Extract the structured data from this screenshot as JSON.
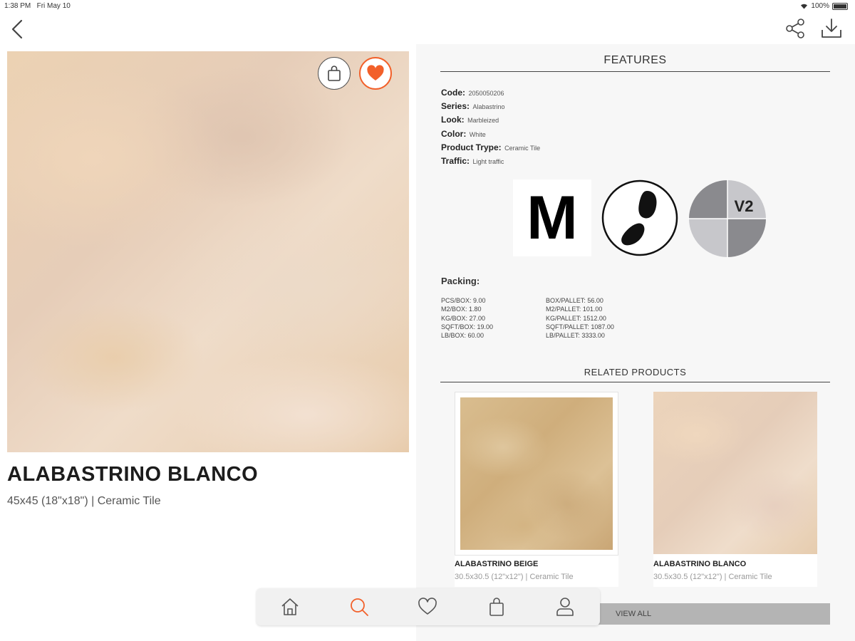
{
  "status_bar": {
    "time": "1:38 PM",
    "date": "Fri May 10",
    "battery": "100%"
  },
  "colors": {
    "accent": "#f2602a",
    "panel_background": "#f7f7f7",
    "view_all_background": "#b4b4b4"
  },
  "icons": {
    "back": "chevron-left-icon",
    "share": "share-icon",
    "download": "download-icon",
    "add_to_bag": "shopping-bag-icon",
    "favorite": "heart-filled-icon"
  },
  "product": {
    "title": "ALABASTRINO BLANCO",
    "subtitle": "45x45 (18\"x18\") | Ceramic Tile",
    "favorited": true
  },
  "features": {
    "header": "FEATURES",
    "rows": [
      {
        "key": "Code:",
        "value": "2050050206"
      },
      {
        "key": "Series:",
        "value": "Alabastrino"
      },
      {
        "key": "Look:",
        "value": "Marbleized"
      },
      {
        "key": "Color:",
        "value": "White"
      },
      {
        "key": "Product Trype:",
        "value": "Ceramic Tile"
      },
      {
        "key": "Traffic:",
        "value": "Light traffic"
      }
    ],
    "badges": [
      {
        "name": "finish-badge",
        "text": "M"
      },
      {
        "name": "traffic-badge",
        "icon": "footprint-icon"
      },
      {
        "name": "shade-variation-badge",
        "text": "V2"
      }
    ]
  },
  "packing": {
    "title": "Packing:",
    "left": [
      "PCS/BOX: 9.00",
      "M2/BOX: 1.80",
      "KG/BOX: 27.00",
      "SQFT/BOX: 19.00",
      "LB/BOX: 60.00"
    ],
    "right": [
      "BOX/PALLET: 56.00",
      "M2/PALLET: 101.00",
      "KG/PALLET: 1512.00",
      "SQFT/PALLET: 1087.00",
      "LB/PALLET: 3333.00"
    ]
  },
  "related": {
    "header": "RELATED PRODUCTS",
    "items": [
      {
        "name": "ALABASTRINO BEIGE",
        "subtitle": "30.5x30.5 (12\"x12\") | Ceramic Tile"
      },
      {
        "name": "ALABASTRINO BLANCO",
        "subtitle": "30.5x30.5 (12\"x12\") | Ceramic Tile"
      }
    ],
    "view_all_label": "VIEW ALL"
  },
  "tabbar": {
    "active": "search",
    "items": [
      {
        "id": "home",
        "icon": "home-icon"
      },
      {
        "id": "search",
        "icon": "search-icon"
      },
      {
        "id": "favorites",
        "icon": "heart-icon"
      },
      {
        "id": "cart",
        "icon": "shopping-bag-icon"
      },
      {
        "id": "profile",
        "icon": "user-icon"
      }
    ]
  }
}
